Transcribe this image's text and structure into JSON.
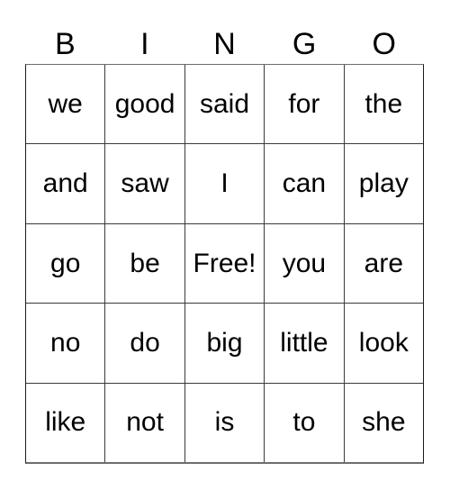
{
  "card": {
    "title": "BINGO",
    "header": {
      "letters": [
        "B",
        "I",
        "N",
        "G",
        "O"
      ]
    },
    "grid": {
      "rows": [
        {
          "cells": [
            {
              "text": "we",
              "free": false
            },
            {
              "text": "good",
              "free": false
            },
            {
              "text": "said",
              "free": false
            },
            {
              "text": "for",
              "free": false
            },
            {
              "text": "the",
              "free": false
            }
          ]
        },
        {
          "cells": [
            {
              "text": "and",
              "free": false
            },
            {
              "text": "saw",
              "free": false
            },
            {
              "text": "I",
              "free": false
            },
            {
              "text": "can",
              "free": false
            },
            {
              "text": "play",
              "free": false
            }
          ]
        },
        {
          "cells": [
            {
              "text": "go",
              "free": false
            },
            {
              "text": "be",
              "free": false
            },
            {
              "text": "Free!",
              "free": true
            },
            {
              "text": "you",
              "free": false
            },
            {
              "text": "are",
              "free": false
            }
          ]
        },
        {
          "cells": [
            {
              "text": "no",
              "free": false
            },
            {
              "text": "do",
              "free": false
            },
            {
              "text": "big",
              "free": false
            },
            {
              "text": "little",
              "free": false
            },
            {
              "text": "look",
              "free": false
            }
          ]
        },
        {
          "cells": [
            {
              "text": "like",
              "free": false
            },
            {
              "text": "not",
              "free": false
            },
            {
              "text": "is",
              "free": false
            },
            {
              "text": "to",
              "free": false
            },
            {
              "text": "she",
              "free": false
            }
          ]
        }
      ]
    },
    "colors": {
      "background": "#ffffff",
      "text": "#000000",
      "grid_line": "#3a3a3a",
      "outer_line": "#6e6e6e"
    }
  }
}
